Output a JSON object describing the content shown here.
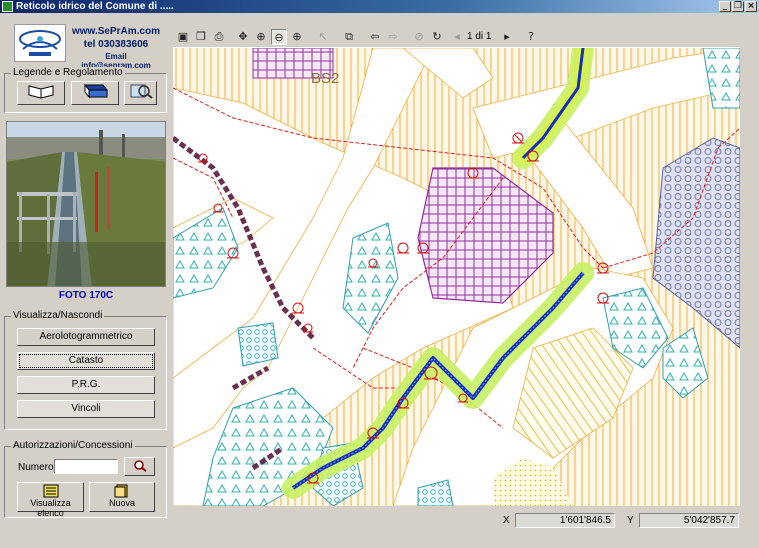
{
  "window": {
    "title": "Reticolo idrico del Comune di ....."
  },
  "header": {
    "website": "www.SePrAm.com",
    "phone": "tel 030383606",
    "email": "Email info@sepram.com"
  },
  "legende": {
    "title": "Legende e Regolamento"
  },
  "photo": {
    "caption": "FOTO 170C"
  },
  "layers": {
    "title": "Visualizza/Nascondi",
    "buttons": [
      "Aerolotogrammetrico",
      "Catasto",
      "P.R.G.",
      "Vincoli"
    ]
  },
  "authorizations": {
    "title": "Autorizzazioni/Concessioni",
    "numero_label": "Numero",
    "numero_value": "",
    "view_list_label": "Visualizza elenco",
    "new_label": "Nuova"
  },
  "toolbar": {
    "page_indicator": "1 di 1"
  },
  "map": {
    "zone_label": "BS2"
  },
  "status": {
    "x_label": "X",
    "x_value": "1'601'846.5",
    "y_label": "Y",
    "y_value": "5'042'857.7"
  },
  "colors": {
    "title_bar": "#0a246a",
    "map_hatch": "#f0b040",
    "channel": "#1030c0",
    "buffer": "#c8f064",
    "boundary": "#e02020",
    "parcel_purple": "#9030a0",
    "vincolo_teal": "#30c0c0"
  }
}
